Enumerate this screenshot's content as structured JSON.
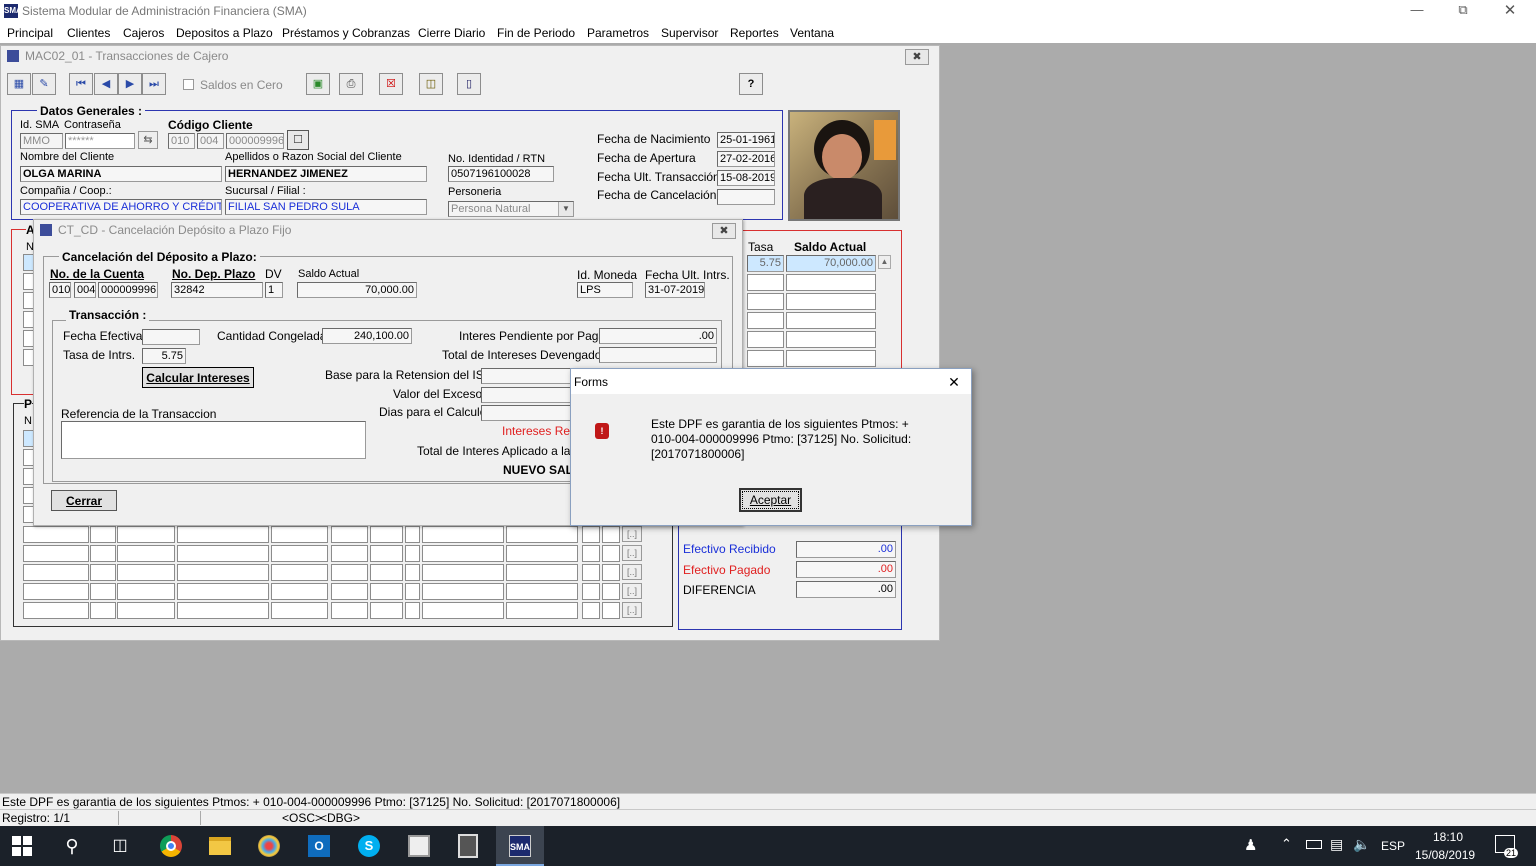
{
  "app": {
    "title": "Sistema Modular de Administración Financiera (SMA)",
    "menu": [
      "Principal",
      "Clientes",
      "Cajeros",
      "Depositos a Plazo",
      "Préstamos y Cobranzas",
      "Cierre Diario",
      "Fin de Periodo",
      "Parametros",
      "Supervisor",
      "Reportes",
      "Ventana"
    ]
  },
  "main_window": {
    "title": "MAC02_01 - Transacciones de Cajero",
    "saldos_en_cero": "Saldos en Cero",
    "help": "?",
    "datos_generales": "Datos Generales :",
    "id_sma_label": "Id. SMA",
    "contrasena_label": "Contraseña",
    "codigo_cliente_label": "Código Cliente",
    "id_sma": "MMO",
    "contrasena": "******",
    "codigo_cliente": [
      "010",
      "004",
      "000009996"
    ],
    "nombre_label": "Nombre del Cliente",
    "nombre": "OLGA MARINA",
    "apellidos_label": "Apellidos o Razon Social del Cliente",
    "apellidos": "HERNANDEZ JIMENEZ",
    "identidad_label": "No. Identidad / RTN",
    "identidad": "0507196100028",
    "compania_label": "Compañia / Coop.:",
    "compania": "COOPERATIVA DE AHORRO Y CRÉDITO",
    "sucursal_label": "Sucursal / Filial :",
    "sucursal": "FILIAL SAN PEDRO SULA",
    "personeria_label": "Personeria",
    "personeria": "Persona Natural",
    "fecha_nacimiento_label": "Fecha de Nacimiento",
    "fecha_nacimiento": "25-01-1961",
    "fecha_apertura_label": "Fecha de  Apertura",
    "fecha_apertura": "27-02-2016",
    "fecha_ult_label": "Fecha Ult. Transacción",
    "fecha_ult": "15-08-2019",
    "fecha_cancel_label": "Fecha de Cancelación",
    "fecha_cancel": "",
    "tasa_header": "Tasa",
    "saldo_header": "Saldo Actual",
    "tasa_value": "5.75",
    "saldo_value": "70,000.00",
    "efectivo_recibido_label": "Efectivo Recibido",
    "efectivo_recibido": ".00",
    "efectivo_pagado_label": "Efectivo Pagado",
    "efectivo_pagado": ".00",
    "diferencia_label": "DIFERENCIA",
    "diferencia": ".00",
    "left_letters": [
      "A",
      "N",
      "P",
      "N"
    ]
  },
  "cancel_window": {
    "title": "CT_CD - Cancelación Depósito a Plazo Fijo",
    "group1": "Cancelación del Déposito a Plazo:",
    "no_cuenta_label": "No. de la Cuenta",
    "no_cuenta": [
      "010",
      "004",
      "000009996"
    ],
    "no_dep_label": "No. Dep. Plazo",
    "no_dep": "32842",
    "dv_label": "DV",
    "dv": "1",
    "saldo_label": "Saldo Actual",
    "saldo": "70,000.00",
    "moneda_label": "Id. Moneda",
    "moneda": "LPS",
    "fecha_intrs_label": "Fecha Ult. Intrs.",
    "fecha_intrs": "31-07-2019",
    "transaccion_label": "Transacción :",
    "fecha_efectiva_label": "Fecha Efectiva",
    "fecha_efectiva": "",
    "cantidad_label": "Cantidad Congelada",
    "cantidad": "240,100.00",
    "intereses_pendiente_label": "Interes Pendiente por Pagar",
    "intereses_pendiente": ".00",
    "tasa_label": "Tasa de Intrs.",
    "tasa": "5.75",
    "total_devengados_label": "Total de Intereses Devengados",
    "calcular_button": "Calcular Intereses",
    "base_isr_label": "Base para la Retension del ISR",
    "valor_exceso_label": "Valor del Exceso",
    "dias_calculo_label": "Dias para el Calculo",
    "referencia_label": "Referencia de la Transaccion",
    "intereses_retenidos_label": "Intereses Rete",
    "total_aplicado_label": "Total de Interes Aplicado a la cu",
    "nuevo_saldo_label": "NUEVO SAL",
    "cerrar_button": "Cerrar"
  },
  "dialog": {
    "title": "Forms",
    "close": "✕",
    "message_line1": "Este DPF es garantia de los siguientes Ptmos:  +",
    "message_line2": "010-004-000009996 Ptmo: [37125] No. Solicitud:",
    "message_line3": "[2017071800006]",
    "ok_button": "Aceptar"
  },
  "status": {
    "message": "Este DPF es garantia de los siguientes Ptmos:  + 010-004-000009996 Ptmo: [37125] No. Solicitud: [2017071800006]",
    "registro": "Registro: 1/1",
    "osc": "<OSC>",
    "dbg": "<DBG>"
  },
  "taskbar": {
    "lang": "ESP",
    "time": "18:10",
    "date": "15/08/2019",
    "notifications": "21"
  }
}
